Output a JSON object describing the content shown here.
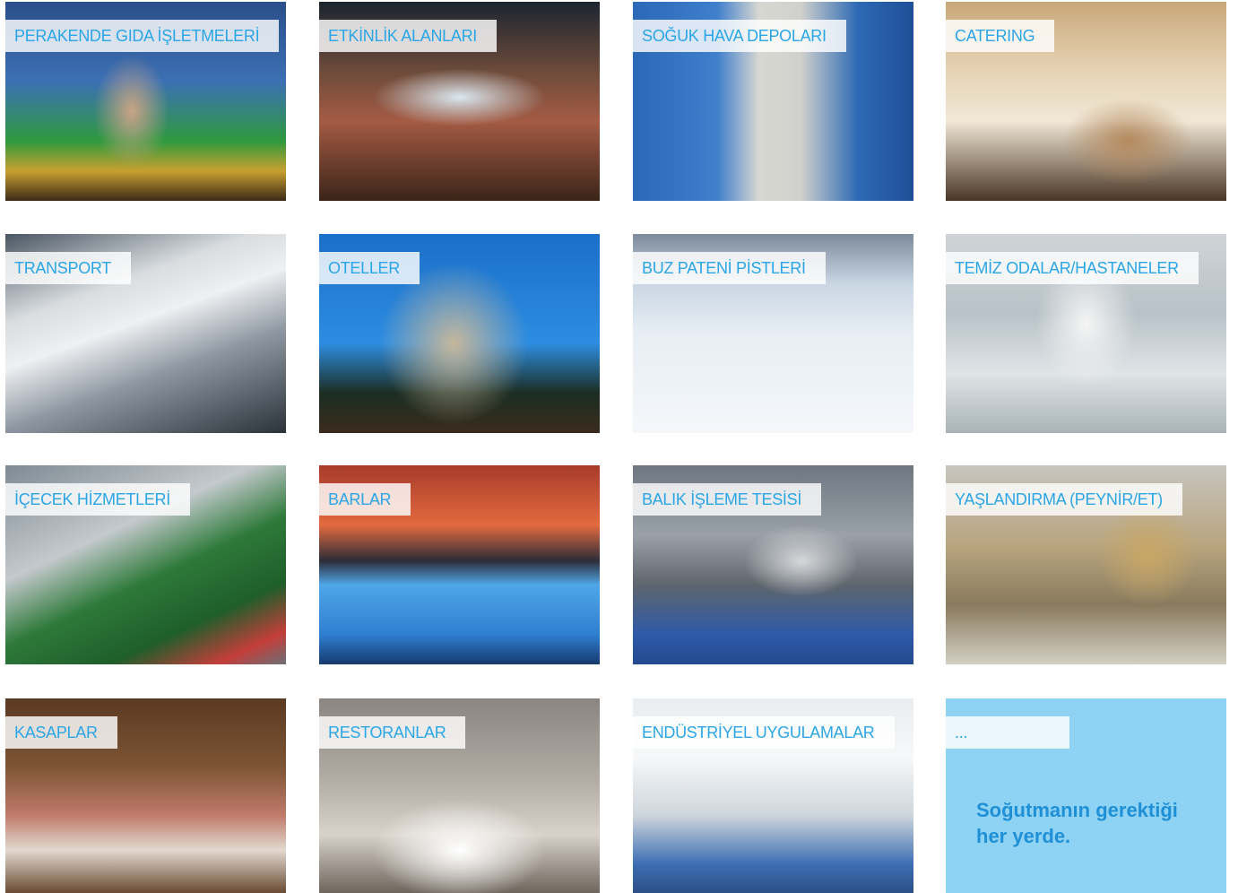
{
  "tiles": [
    {
      "label": "PERAKENDE GIDA İŞLETMELERİ"
    },
    {
      "label": "ETKİNLİK ALANLARI"
    },
    {
      "label": "SOĞUK HAVA DEPOLARI"
    },
    {
      "label": "CATERING"
    },
    {
      "label": "TRANSPORT"
    },
    {
      "label": "OTELLER"
    },
    {
      "label": "BUZ PATENİ PİSTLERİ"
    },
    {
      "label": "TEMİZ ODALAR/HASTANELER"
    },
    {
      "label": "İÇECEK HİZMETLERİ"
    },
    {
      "label": "BARLAR"
    },
    {
      "label": "BALIK İŞLEME TESİSİ"
    },
    {
      "label": "YAŞLANDIRMA (PEYNİR/ET)"
    },
    {
      "label": "KASAPLAR"
    },
    {
      "label": "RESTORANLAR"
    },
    {
      "label": "ENDÜSTRİYEL UYGULAMALAR"
    }
  ],
  "panel": {
    "label": "...",
    "slogan_line1": "Soğutmanın gerektiği",
    "slogan_line2": "her yerde.",
    "color": "#8fd3f4"
  }
}
